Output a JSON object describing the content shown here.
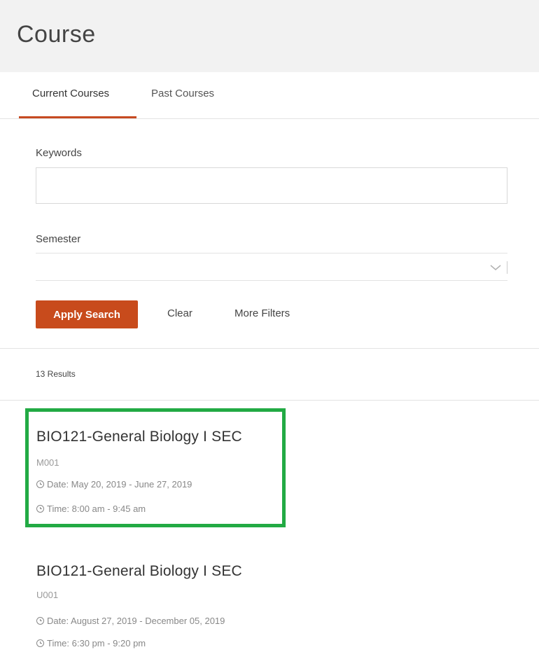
{
  "page": {
    "title": "Course"
  },
  "tabs": [
    {
      "label": "Current Courses",
      "active": true
    },
    {
      "label": "Past Courses",
      "active": false
    }
  ],
  "filters": {
    "keywords_label": "Keywords",
    "keywords_value": "",
    "semester_label": "Semester",
    "semester_value": ""
  },
  "actions": {
    "apply_label": "Apply Search",
    "clear_label": "Clear",
    "more_filters_label": "More Filters"
  },
  "results": {
    "count_label": "13 Results",
    "courses": [
      {
        "title": "BIO121-General Biology I SEC",
        "section": "M001",
        "date": "Date: May 20, 2019 - June 27, 2019",
        "time": "Time: 8:00 am - 9:45 am",
        "highlighted": true
      },
      {
        "title": "BIO121-General Biology I SEC",
        "section": "U001",
        "date": "Date: August 27, 2019 - December 05, 2019",
        "time": "Time: 6:30 pm - 9:20 pm",
        "highlighted": false
      }
    ]
  },
  "colors": {
    "accent": "#c84b1c",
    "highlight": "#22aa44",
    "header_bg": "#f2f2f2"
  },
  "icons": {
    "meta_icon": "clock-icon",
    "select_icon": "chevron-down-icon"
  }
}
